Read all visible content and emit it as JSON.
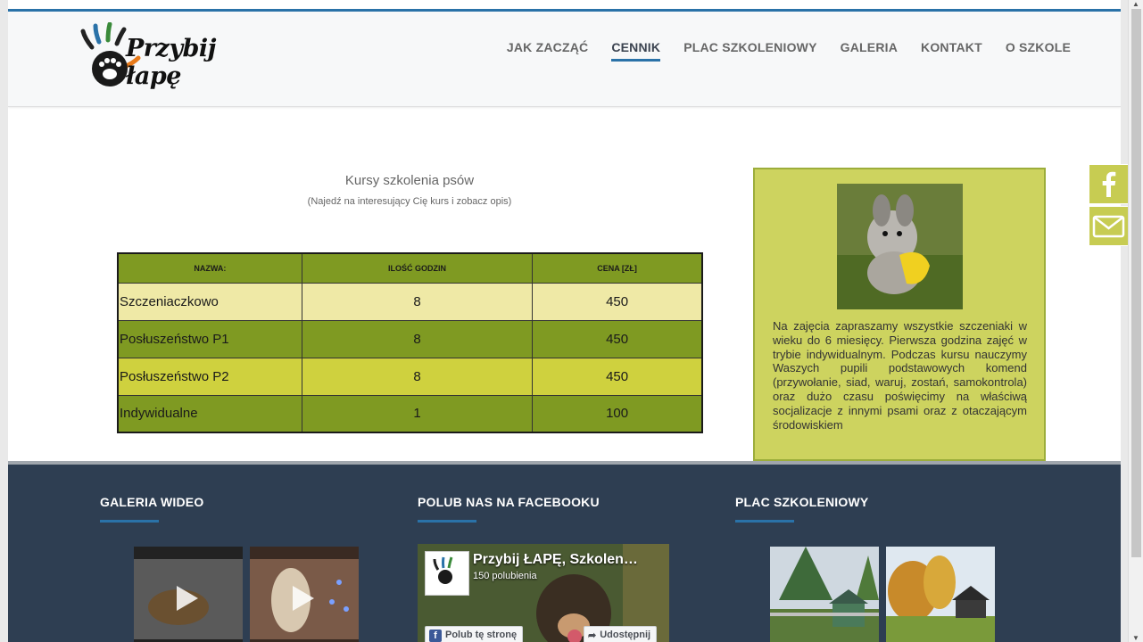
{
  "header": {
    "logo_text": "Przybij łapę",
    "nav": [
      {
        "label": "JAK ZACZĄĆ",
        "active": false
      },
      {
        "label": "CENNIK",
        "active": true
      },
      {
        "label": "PLAC SZKOLENIOWY",
        "active": false
      },
      {
        "label": "GALERIA",
        "active": false
      },
      {
        "label": "KONTAKT",
        "active": false
      },
      {
        "label": "O SZKOLE",
        "active": false
      }
    ]
  },
  "courses": {
    "title": "Kursy szkolenia psów",
    "subtitle": "(Najedź na interesujący Cię kurs i zobacz opis)",
    "table": {
      "headers": [
        "NAZWA:",
        "ILOŚĆ GODZIN",
        "CENA [ZŁ]"
      ],
      "rows": [
        {
          "name": "Szczeniaczkowo",
          "hours": "8",
          "price": "450"
        },
        {
          "name": "Posłuszeństwo P1",
          "hours": "8",
          "price": "450"
        },
        {
          "name": "Posłuszeństwo P2",
          "hours": "8",
          "price": "450"
        },
        {
          "name": "Indywidualne",
          "hours": "1",
          "price": "100"
        }
      ]
    }
  },
  "info_box": {
    "description": "Na zajęcia zapraszamy wszystkie szczeniaki w wieku do 6 miesięcy. Pierwsza godzina zajęć w trybie indywidualnym. Podczas kursu nauczymy Waszych pupili podstawowych komend (przywołanie, siad, waruj, zostań, samokontrola) oraz dużo czasu poświęcimy na właściwą socjalizacje z innymi psami oraz z otaczającym środowiskiem"
  },
  "footer": {
    "video_title": "GALERIA WIDEO",
    "facebook_title": "POLUB NAS NA FACEBOOKU",
    "yard_title": "PLAC SZKOLENIOWY",
    "facebook": {
      "page_name": "Przybij ŁAPĘ, Szkolen…",
      "likes": "150 polubienia",
      "like_button": "Polub tę stronę",
      "share_button": "Udostępnij",
      "mini_logo_text": "Przybij łapę"
    }
  },
  "colors": {
    "accent_blue": "#2a72a8",
    "table_green": "#7f9a22",
    "table_light": "#efe9a6",
    "table_yellow": "#cfd13e",
    "info_bg": "#cdd35f",
    "footer_bg": "#2e3e52"
  },
  "icons": {
    "social_top": "facebook-icon",
    "social_bottom": "mail-icon"
  }
}
